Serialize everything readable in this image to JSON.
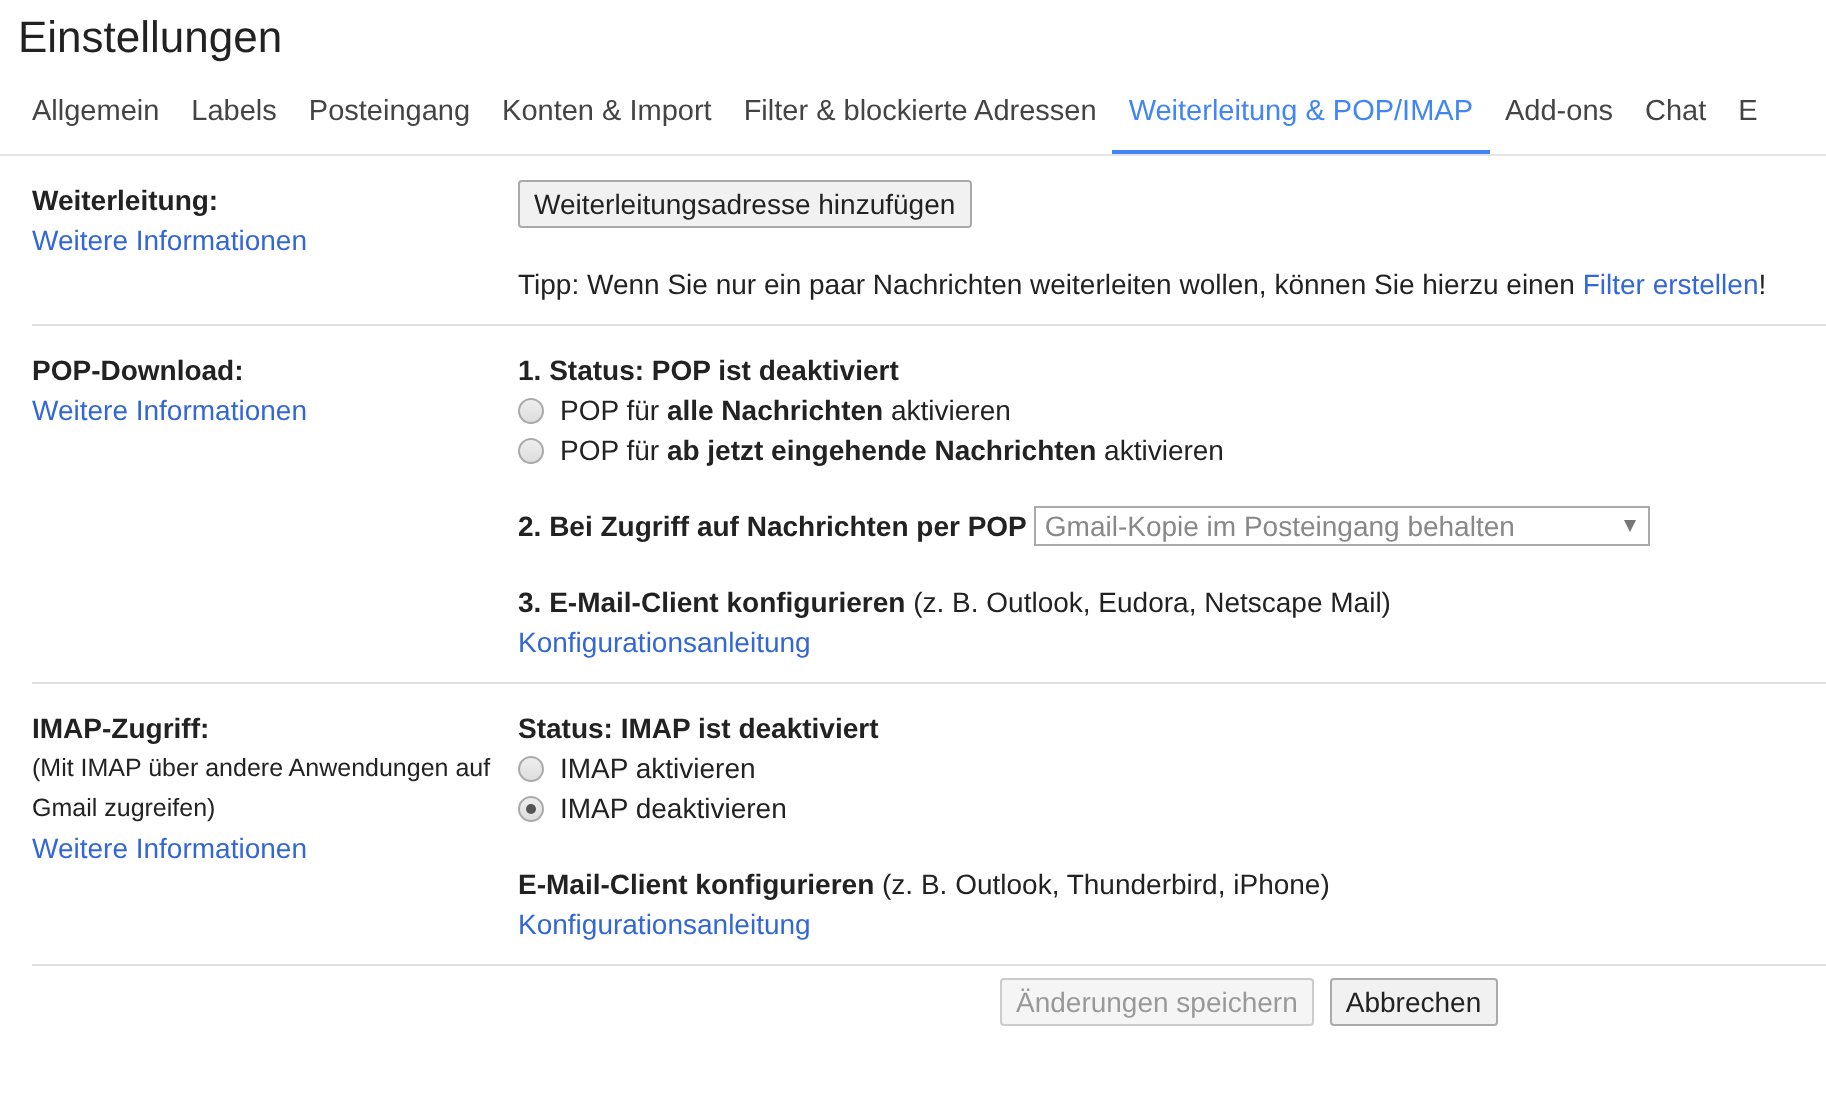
{
  "page_title": "Einstellungen",
  "tabs": [
    {
      "label": "Allgemein",
      "selected": false
    },
    {
      "label": "Labels",
      "selected": false
    },
    {
      "label": "Posteingang",
      "selected": false
    },
    {
      "label": "Konten & Import",
      "selected": false
    },
    {
      "label": "Filter & blockierte Adressen",
      "selected": false
    },
    {
      "label": "Weiterleitung & POP/IMAP",
      "selected": true
    },
    {
      "label": "Add-ons",
      "selected": false
    },
    {
      "label": "Chat",
      "selected": false
    },
    {
      "label": "E",
      "selected": false
    }
  ],
  "sections": [
    {
      "label": "Weiterleitung:",
      "info_link": "Weitere Informationen",
      "groups": [
        [
          {
            "kind": "button",
            "text": "Weiterleitungsadresse hinzufügen"
          }
        ],
        [
          {
            "kind": "tip",
            "text": "Tipp: Wenn Sie nur ein paar Nachrichten weiterleiten wollen, können Sie hierzu einen ",
            "link": "Filter erstellen",
            "after": "!"
          }
        ]
      ]
    },
    {
      "label": "POP-Download:",
      "info_link": "Weitere Informationen",
      "groups": [
        [
          {
            "kind": "heading",
            "text": "1. Status: POP ist deaktiviert"
          },
          {
            "kind": "radio",
            "text": "POP für **alle Nachrichten** aktivieren",
            "selected": false
          },
          {
            "kind": "radio",
            "text": "POP für **ab jetzt eingehende Nachrichten** aktivieren",
            "selected": false
          }
        ],
        [
          {
            "kind": "select",
            "text": "2. Bei Zugriff auf Nachrichten per POP",
            "value": "Gmail-Kopie im Posteingang behalten",
            "disabled": true
          }
        ],
        [
          {
            "kind": "text",
            "text": "**3. E-Mail-Client konfigurieren** (z. B. Outlook, Eudora, Netscape Mail)"
          },
          {
            "kind": "link",
            "text": "Konfigurationsanleitung"
          }
        ]
      ]
    },
    {
      "label": "IMAP-Zugriff:",
      "note": "(Mit IMAP über andere Anwendungen auf Gmail zugreifen)",
      "info_link": "Weitere Informationen",
      "groups": [
        [
          {
            "kind": "heading",
            "text": "Status: IMAP ist deaktiviert"
          },
          {
            "kind": "radio",
            "text": "IMAP aktivieren",
            "selected": false
          },
          {
            "kind": "radio",
            "text": "IMAP deaktivieren",
            "selected": true
          }
        ],
        [
          {
            "kind": "text",
            "text": "**E-Mail-Client konfigurieren** (z. B. Outlook, Thunderbird, iPhone)"
          },
          {
            "kind": "link",
            "text": "Konfigurationsanleitung"
          }
        ]
      ]
    }
  ],
  "buttons": [
    {
      "label": "Änderungen speichern",
      "disabled": true
    },
    {
      "label": "Abbrechen",
      "disabled": false
    }
  ]
}
